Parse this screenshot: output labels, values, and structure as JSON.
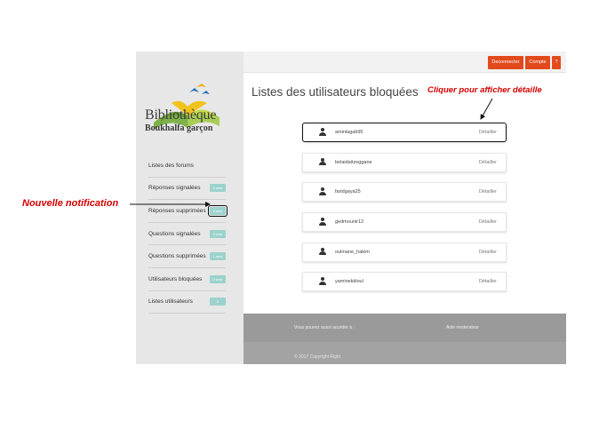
{
  "logo": {
    "title": "Bibliothèque",
    "subtitle": "Boukhalfa garçon"
  },
  "sidebar": {
    "items": [
      {
        "label": "Listes des forums",
        "badge": ""
      },
      {
        "label": "Réponses signalées",
        "badge": "0 new"
      },
      {
        "label": "Réponses supprimées",
        "badge": "0 new"
      },
      {
        "label": "Questions signalées",
        "badge": "0 new"
      },
      {
        "label": "Questions supprimées",
        "badge": "1 new"
      },
      {
        "label": "Utilisateurs bloquées",
        "badge": "0 new"
      },
      {
        "label": "Listes utilisateurs",
        "badge": "0"
      }
    ]
  },
  "topbar": {
    "deconnecter": "Deconnecter",
    "compte": "Compte",
    "help": "?"
  },
  "main": {
    "title": "Listes des utilisateurs bloquées",
    "users": [
      {
        "name": "aminlagab95",
        "action": "Détailler"
      },
      {
        "name": "belaidaitzeggane",
        "action": "Détailler"
      },
      {
        "name": "faridgaya25",
        "action": "Détailler"
      },
      {
        "name": "gedmounir12",
        "action": "Détailler"
      },
      {
        "name": "oulmane_hakim",
        "action": "Détailler"
      },
      {
        "name": "yaminekkloul",
        "action": "Détailler"
      }
    ]
  },
  "footer": {
    "access_text": "Vous pouvez aussi accéder à :",
    "help_link": "Aide moderateur",
    "copyright": "© 2017 Copyright Right"
  },
  "annotations": {
    "notification": "Nouvelle notification",
    "detail": "Cliquer pour afficher détaille"
  },
  "colors": {
    "accent": "#e24a1c",
    "badge": "#9bd2cc",
    "annotation": "#d40000",
    "sidebar_bg": "#e7e7e7",
    "footer_bg": "#a3a3a3"
  }
}
